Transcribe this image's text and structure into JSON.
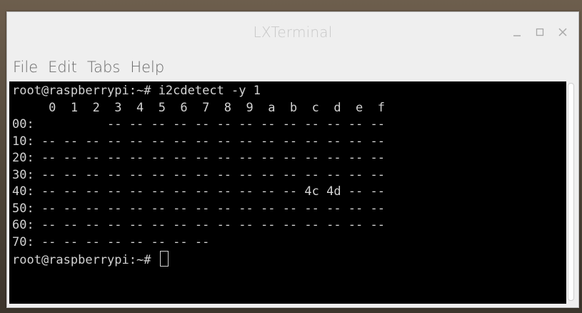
{
  "window": {
    "title": "LXTerminal",
    "minimize_icon": "minimize-icon",
    "maximize_icon": "maximize-icon",
    "close_icon": "close-icon"
  },
  "menu": {
    "items": [
      {
        "label": "File"
      },
      {
        "label": "Edit"
      },
      {
        "label": "Tabs"
      },
      {
        "label": "Help"
      }
    ]
  },
  "terminal": {
    "lines": [
      "root@raspberrypi:~# i2cdetect -y 1",
      "     0  1  2  3  4  5  6  7  8  9  a  b  c  d  e  f",
      "00:          -- -- -- -- -- -- -- -- -- -- -- -- --",
      "10: -- -- -- -- -- -- -- -- -- -- -- -- -- -- -- --",
      "20: -- -- -- -- -- -- -- -- -- -- -- -- -- -- -- --",
      "30: -- -- -- -- -- -- -- -- -- -- -- -- -- -- -- --",
      "40: -- -- -- -- -- -- -- -- -- -- -- -- 4c 4d -- --",
      "50: -- -- -- -- -- -- -- -- -- -- -- -- -- -- -- --",
      "60: -- -- -- -- -- -- -- -- -- -- -- -- -- -- -- --",
      "70: -- -- -- -- -- -- -- --"
    ],
    "prompt": "root@raspberrypi:~# "
  },
  "colors": {
    "terminal_bg": "#000000",
    "terminal_fg": "#d3d3d3",
    "chrome_bg": "#efefef"
  }
}
